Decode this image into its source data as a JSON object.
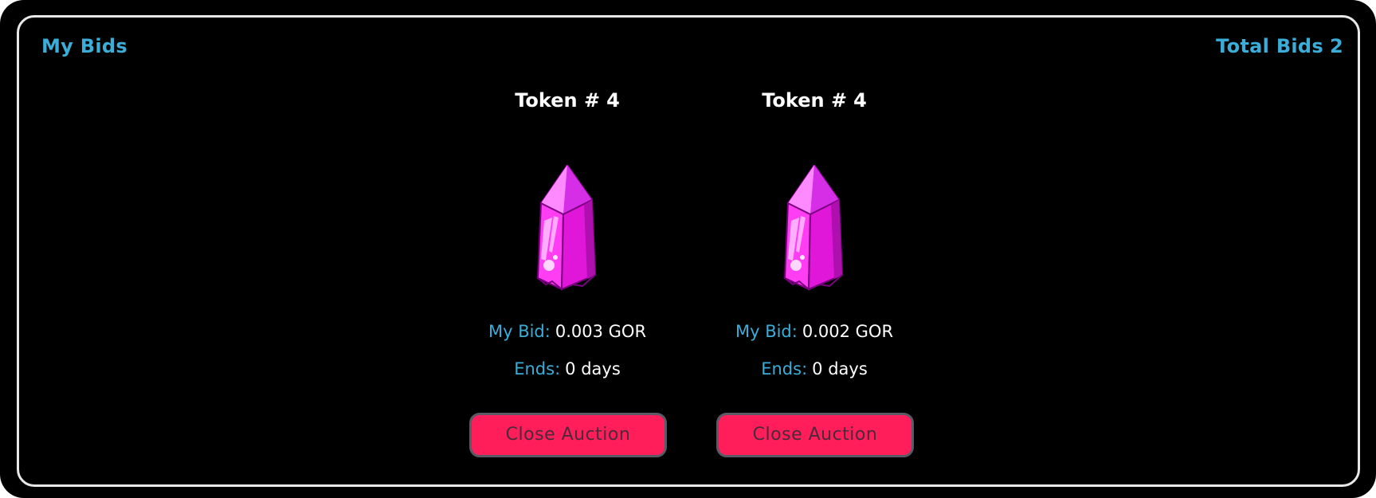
{
  "header": {
    "title": "My Bids",
    "total_label": "Total Bids",
    "total_count": "2"
  },
  "bids": [
    {
      "token_label": "Token #",
      "token_id": "4",
      "image": "pink-crystal",
      "bid_label": "My Bid:",
      "bid_value": "0.003 GOR",
      "ends_label": "Ends:",
      "ends_value": "0 days",
      "button_label": "Close Auction"
    },
    {
      "token_label": "Token #",
      "token_id": "4",
      "image": "pink-crystal",
      "bid_label": "My Bid:",
      "bid_value": "0.002 GOR",
      "ends_label": "Ends:",
      "ends_value": "0 days",
      "button_label": "Close Auction"
    }
  ],
  "colors": {
    "background": "#000000",
    "accent": "#3aaed8",
    "button": "#ff1e5a",
    "crystal": "#ff33ee"
  }
}
